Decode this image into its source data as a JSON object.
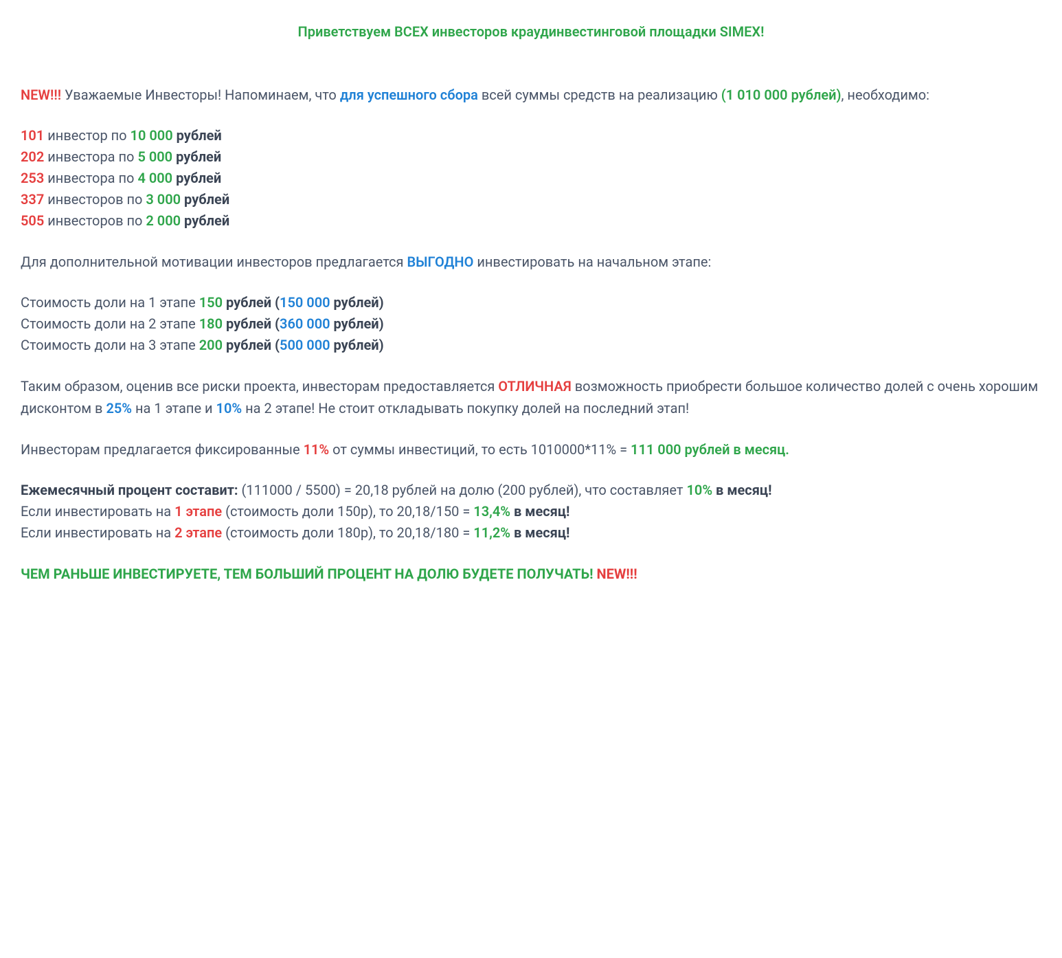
{
  "title": "Приветствуем ВСЕХ инвесторов краудинвестинговой площадки SIMEX!",
  "intro": {
    "new": "NEW!!!",
    "part1": " Уважаемые Инвесторы! Напоминаем, что ",
    "blue": "для успешного сбора",
    "part2": " всей суммы средств на реализацию ",
    "green": "(1 010 000 рублей)",
    "part3": ", необходимо:"
  },
  "investors": [
    {
      "count": "101",
      "word": " инвестор по ",
      "amount": "10 000",
      "unit": " рублей"
    },
    {
      "count": "202",
      "word": " инвестора по ",
      "amount": "5 000",
      "unit": " рублей"
    },
    {
      "count": "253",
      "word": " инвестора по ",
      "amount": "4 000",
      "unit": " рублей"
    },
    {
      "count": "337",
      "word": " инвесторов по ",
      "amount": "3 000",
      "unit": " рублей"
    },
    {
      "count": "505",
      "word": " инвесторов по ",
      "amount": "2 000",
      "unit": " рублей"
    }
  ],
  "motivation": {
    "p1": "Для дополнительной мотивации инвесторов предлагается ",
    "blue": "ВЫГОДНО",
    "p2": " инвестировать на начальном этапе:"
  },
  "stages": [
    {
      "pre": "Стоимость доли на 1 этапе ",
      "cost": "150",
      "mid": " рублей (",
      "total": "150 000",
      "post": " рублей)"
    },
    {
      "pre": "Стоимость доли на 2 этапе ",
      "cost": "180",
      "mid": " рублей (",
      "total": "360 000",
      "post": " рублей)"
    },
    {
      "pre": "Стоимость доли на 3 этапе ",
      "cost": "200",
      "mid": " рублей (",
      "total": "500 000",
      "post": " рублей)"
    }
  ],
  "risk": {
    "p1": "Таким образом, оценив все риски проекта, инвесторам предоставляется ",
    "red": "ОТЛИЧНАЯ",
    "p2": " возможность приобрести большое количество долей с очень хорошим дисконтом в ",
    "blue1": "25%",
    "p3": " на 1 этапе и ",
    "blue2": "10%",
    "p4": " на 2 этапе! Не стоит откладывать покупку долей на последний этап!"
  },
  "fixed": {
    "p1": "Инвесторам предлагается фиксированные ",
    "red": "11%",
    "p2": " от суммы инвестиций, то есть 1010000*11% = ",
    "green": "111 000 рублей в месяц."
  },
  "monthly": {
    "bold": "Ежемесячный процент составит:",
    "p1": " (111000 / 5500) = 20,18 рублей на долю (200 рублей), что составляет ",
    "green": "10%",
    "p2": " в месяц!"
  },
  "if1": {
    "p1": "Если инвестировать на ",
    "red": "1 этапе",
    "p2": " (стоимость доли 150р), то 20,18/150 = ",
    "green": "13,4%",
    "p3": " в месяц!"
  },
  "if2": {
    "p1": "Если инвестировать на ",
    "red": "2 этапе",
    "p2": " (стоимость доли 180р), то 20,18/180 = ",
    "green": "11,2%",
    "p3": " в месяц!"
  },
  "closing": {
    "green": "ЧЕМ РАНЬШЕ ИНВЕСТИРУЕТЕ, ТЕМ БОЛЬШИЙ ПРОЦЕНТ НА ДОЛЮ БУДЕТЕ ПОЛУЧАТЬ!",
    "red": " NEW!!!"
  }
}
